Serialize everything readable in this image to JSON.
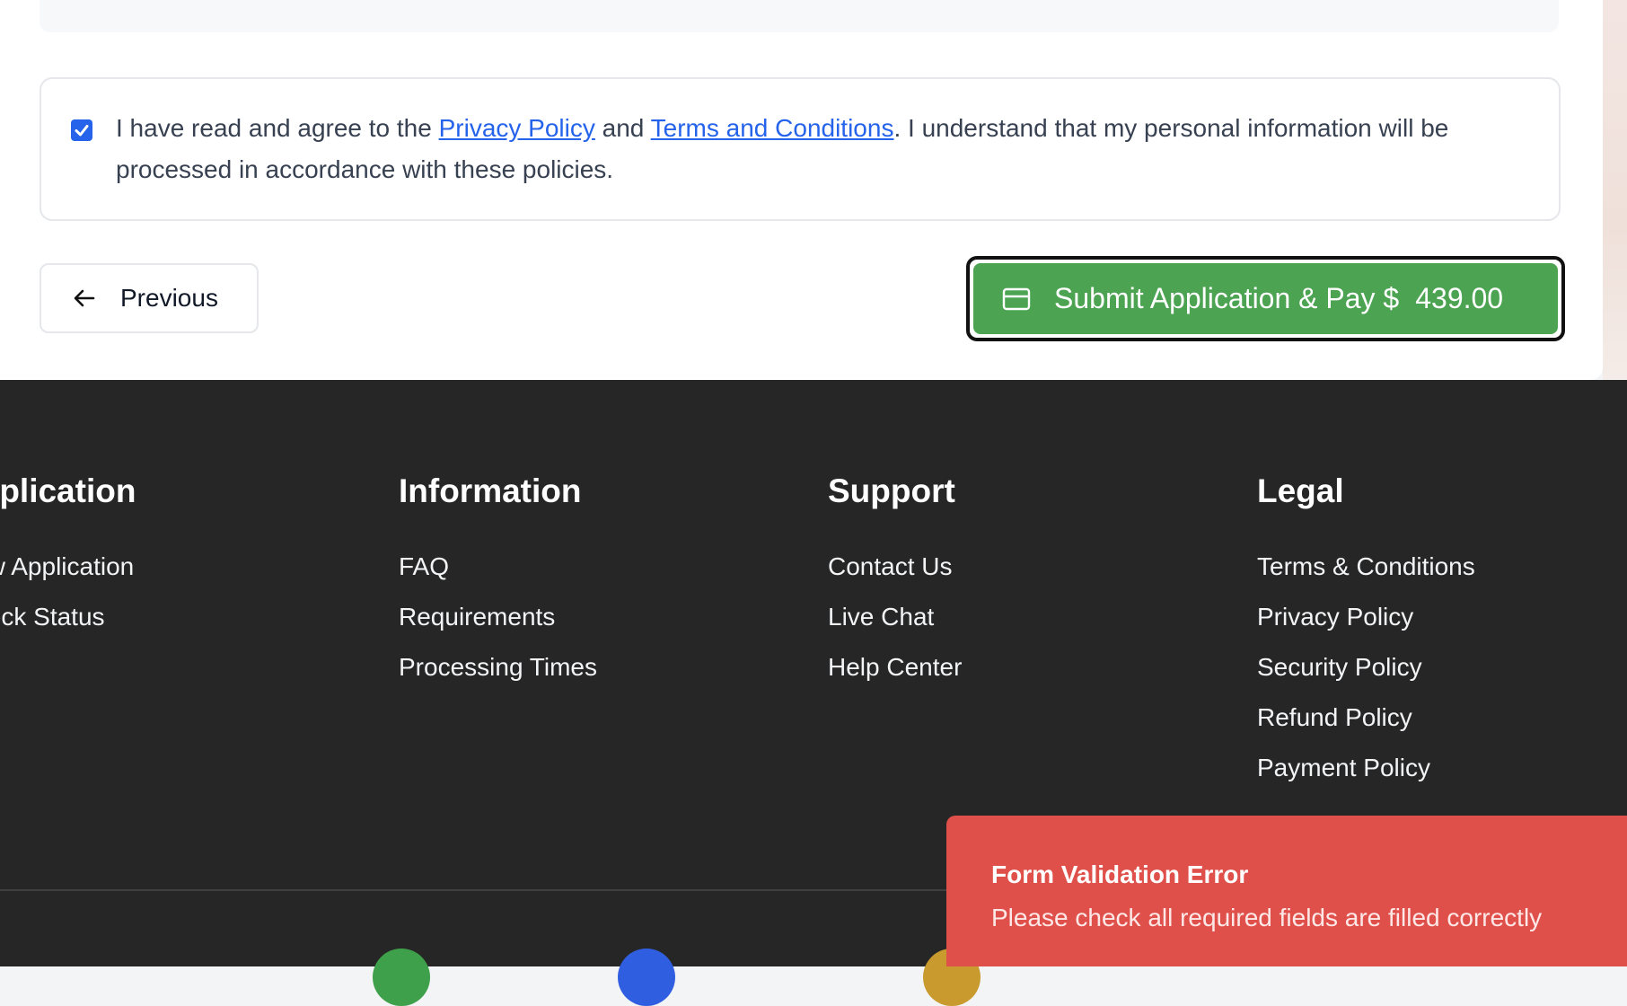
{
  "consent": {
    "checked": true,
    "text_before": "I have read and agree to the ",
    "privacy_link": "Privacy Policy",
    "text_and": " and ",
    "terms_link": "Terms and Conditions",
    "text_after": ". I understand that my personal information will be processed in accordance with these policies."
  },
  "nav": {
    "previous_label": "Previous",
    "submit_label": "Submit Application & Pay $",
    "submit_amount": "439.00"
  },
  "footer": {
    "columns": [
      {
        "heading": "Application",
        "items": [
          "New Application",
          "Check Status"
        ]
      },
      {
        "heading": "Information",
        "items": [
          "FAQ",
          "Requirements",
          "Processing Times"
        ]
      },
      {
        "heading": "Support",
        "items": [
          "Contact Us",
          "Live Chat",
          "Help Center"
        ]
      },
      {
        "heading": "Legal",
        "items": [
          "Terms & Conditions",
          "Privacy Policy",
          "Security Policy",
          "Refund Policy",
          "Payment Policy"
        ]
      }
    ]
  },
  "toast": {
    "title": "Form Validation Error",
    "message": "Please check all required fields are filled correctly"
  },
  "colors": {
    "accent_blue": "#2563eb",
    "submit_green": "#4ca352",
    "footer_bg": "#262626",
    "toast_red": "#e0504b"
  }
}
